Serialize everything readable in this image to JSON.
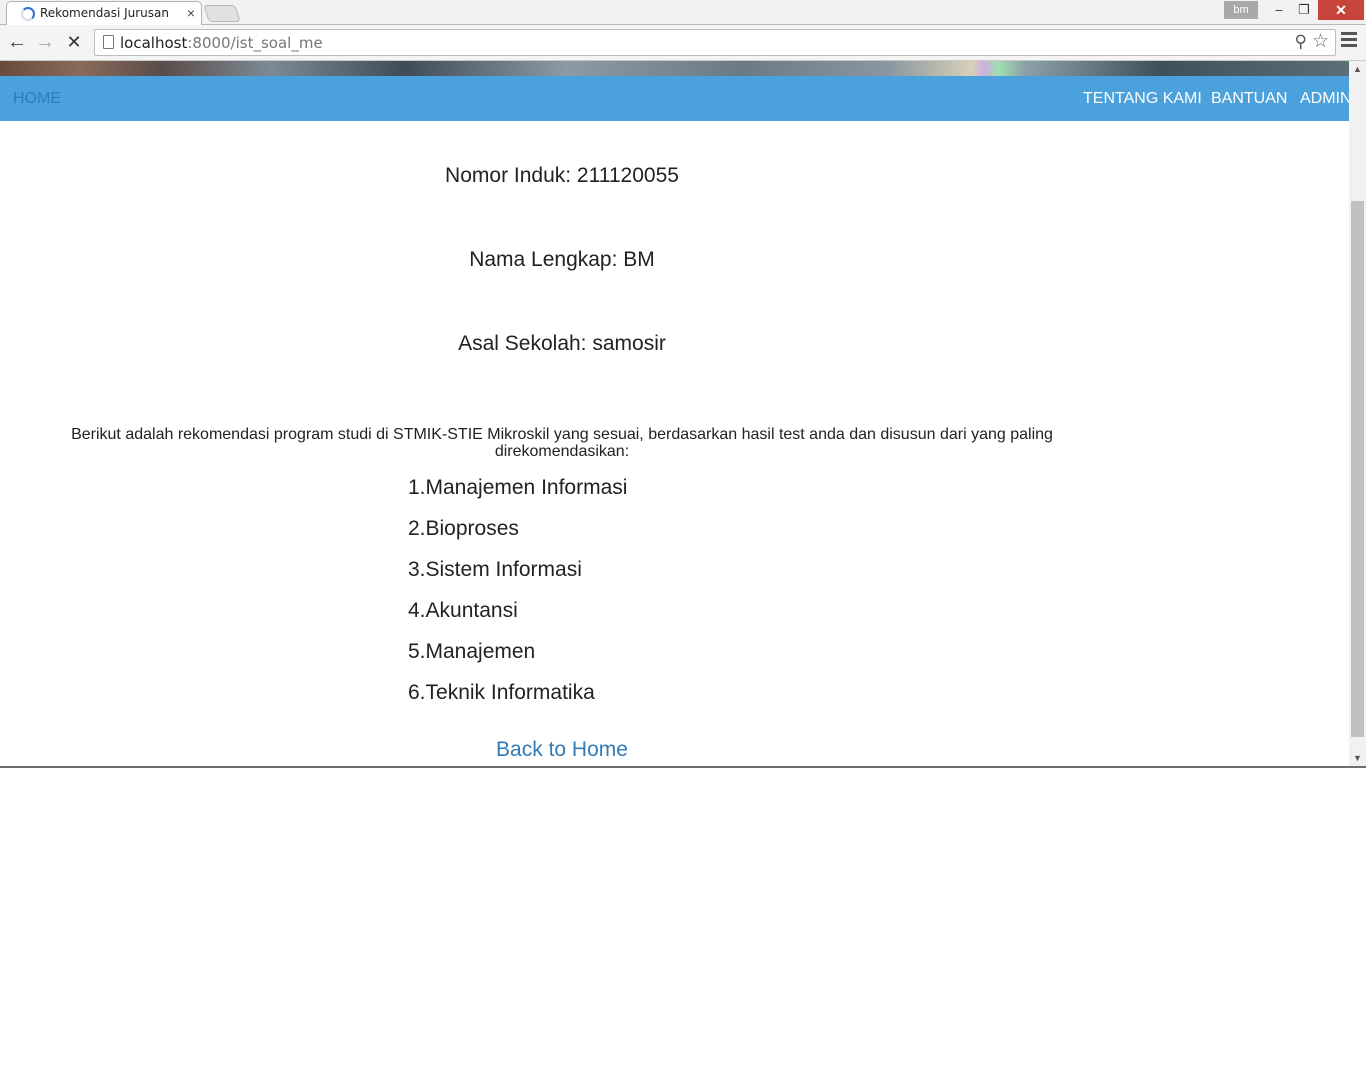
{
  "browser": {
    "tab_title": "Rekomendasi Jurusan",
    "tab_close": "×",
    "profile": "bm",
    "window_controls": {
      "minimize": "–",
      "maximize": "❐",
      "close": "✕"
    },
    "nav": {
      "back": "←",
      "forward": "→",
      "stop": "✕"
    },
    "url_host": "localhost",
    "url_rest": ":8000/ist_soal_me",
    "icons": {
      "zoom": "zoom-icon",
      "star": "star-icon",
      "menu": "menu-icon"
    }
  },
  "navbar": {
    "home": "HOME",
    "links": [
      "TENTANG KAMI",
      "BANTUAN",
      "ADMIN"
    ],
    "bg_color": "#4aa1db"
  },
  "student": {
    "nomor_induk": "Nomor Induk: 211120055",
    "nama_lengkap": "Nama Lengkap: BM",
    "asal_sekolah": "Asal Sekolah: samosir"
  },
  "recommendation": {
    "intro_line1": "Berikut adalah rekomendasi program studi di STMIK-STIE Mikroskil yang sesuai, berdasarkan hasil test anda dan disusun dari yang paling",
    "intro_line2": "direkomendasikan:",
    "items": [
      "1.Manajemen Informasi",
      "2.Bioproses",
      "3.Sistem Informasi",
      "4.Akuntansi",
      "5.Manajemen",
      "6.Teknik Informatika"
    ]
  },
  "back_link": "Back to Home",
  "link_color": "#337ab7"
}
